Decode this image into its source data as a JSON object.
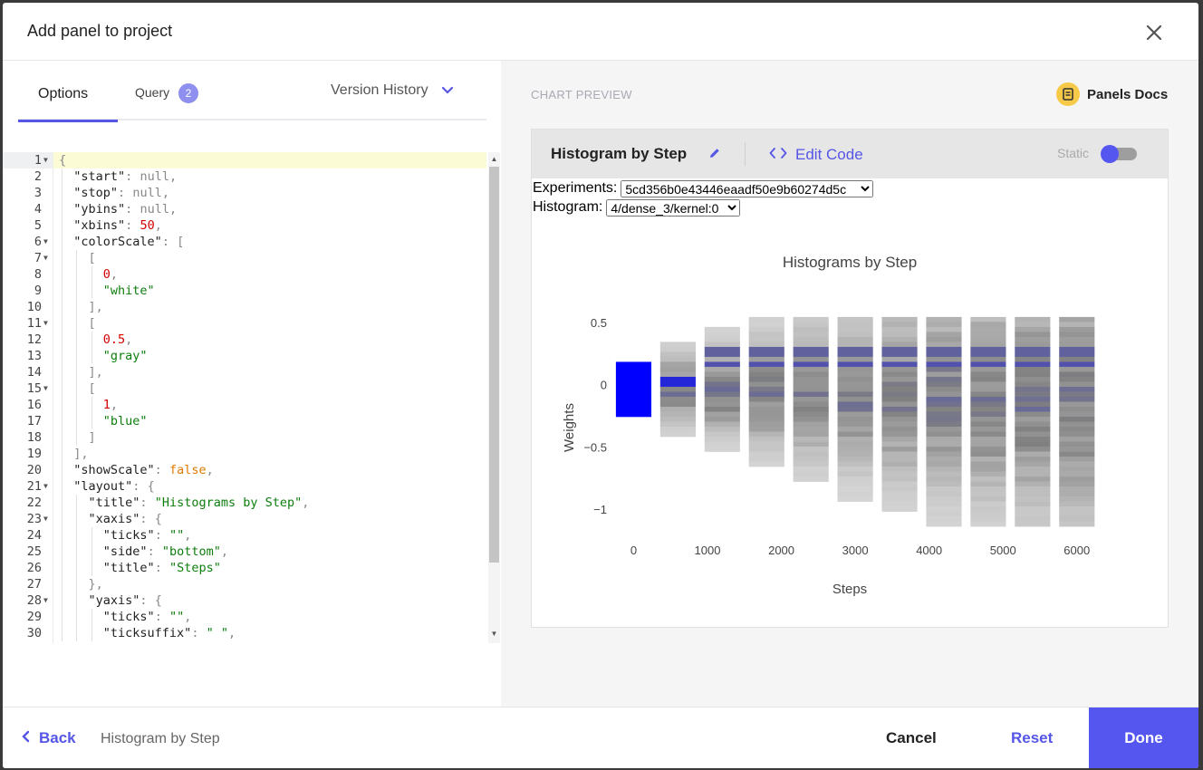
{
  "modal": {
    "title": "Add panel to project",
    "close_icon": "close-icon"
  },
  "tabs": {
    "options_label": "Options",
    "query_label": "Query",
    "query_count": "2",
    "version_history_label": "Version History"
  },
  "code_lines": [
    {
      "n": "1",
      "fold": true,
      "html": "{"
    },
    {
      "n": "2",
      "fold": false,
      "html": "  \"start\": null,"
    },
    {
      "n": "3",
      "fold": false,
      "html": "  \"stop\": null,"
    },
    {
      "n": "4",
      "fold": false,
      "html": "  \"ybins\": null,"
    },
    {
      "n": "5",
      "fold": false,
      "html": "  \"xbins\": 50,"
    },
    {
      "n": "6",
      "fold": true,
      "html": "  \"colorScale\": ["
    },
    {
      "n": "7",
      "fold": true,
      "html": "    ["
    },
    {
      "n": "8",
      "fold": false,
      "html": "      0,"
    },
    {
      "n": "9",
      "fold": false,
      "html": "      \"white\""
    },
    {
      "n": "10",
      "fold": false,
      "html": "    ],"
    },
    {
      "n": "11",
      "fold": true,
      "html": "    ["
    },
    {
      "n": "12",
      "fold": false,
      "html": "      0.5,"
    },
    {
      "n": "13",
      "fold": false,
      "html": "      \"gray\""
    },
    {
      "n": "14",
      "fold": false,
      "html": "    ],"
    },
    {
      "n": "15",
      "fold": true,
      "html": "    ["
    },
    {
      "n": "16",
      "fold": false,
      "html": "      1,"
    },
    {
      "n": "17",
      "fold": false,
      "html": "      \"blue\""
    },
    {
      "n": "18",
      "fold": false,
      "html": "    ]"
    },
    {
      "n": "19",
      "fold": false,
      "html": "  ],"
    },
    {
      "n": "20",
      "fold": false,
      "html": "  \"showScale\": false,"
    },
    {
      "n": "21",
      "fold": true,
      "html": "  \"layout\": {"
    },
    {
      "n": "22",
      "fold": false,
      "html": "    \"title\": \"Histograms by Step\","
    },
    {
      "n": "23",
      "fold": true,
      "html": "    \"xaxis\": {"
    },
    {
      "n": "24",
      "fold": false,
      "html": "      \"ticks\": \"\","
    },
    {
      "n": "25",
      "fold": false,
      "html": "      \"side\": \"bottom\","
    },
    {
      "n": "26",
      "fold": false,
      "html": "      \"title\": \"Steps\""
    },
    {
      "n": "27",
      "fold": false,
      "html": "    },"
    },
    {
      "n": "28",
      "fold": true,
      "html": "    \"yaxis\": {"
    },
    {
      "n": "29",
      "fold": false,
      "html": "      \"ticks\": \"\","
    },
    {
      "n": "30",
      "fold": false,
      "html": "      \"ticksuffix\": \" \","
    }
  ],
  "preview": {
    "label": "CHART PREVIEW",
    "docs_label": "Panels Docs",
    "panel_title": "Histogram by Step",
    "edit_code_label": "Edit Code",
    "static_label": "Static",
    "static_enabled": false,
    "experiments_label": "Experiments:",
    "experiment_value": "5cd356b0e43446eaadf50e9b60274d5c",
    "histogram_label": "Histogram:",
    "histogram_value": "4/dense_3/kernel:0"
  },
  "chart_data": {
    "type": "heatmap",
    "title": "Histograms by Step",
    "xlabel": "Steps",
    "ylabel": "Weights",
    "x_ticks": [
      "0",
      "1000",
      "2000",
      "3000",
      "4000",
      "5000",
      "6000"
    ],
    "y_ticks": [
      "0.5",
      "0",
      "−0.5",
      "−1"
    ],
    "xlim": [
      -300,
      6150
    ],
    "ylim": [
      -1.1,
      0.6
    ],
    "colorscale": [
      [
        0,
        "white"
      ],
      [
        0.5,
        "gray"
      ],
      [
        1,
        "blue"
      ]
    ],
    "steps": [
      0,
      600,
      1200,
      1800,
      2400,
      3000,
      3600,
      4200,
      4800,
      5400,
      6000
    ],
    "bin_width": 0.04
  },
  "footer": {
    "back_label": "Back",
    "crumb": "Histogram by Step",
    "cancel_label": "Cancel",
    "reset_label": "Reset",
    "done_label": "Done"
  },
  "colors": {
    "accent": "#5555f0",
    "string": "#0d7e0d",
    "number": "#d40000",
    "boolean": "#e07a00"
  }
}
